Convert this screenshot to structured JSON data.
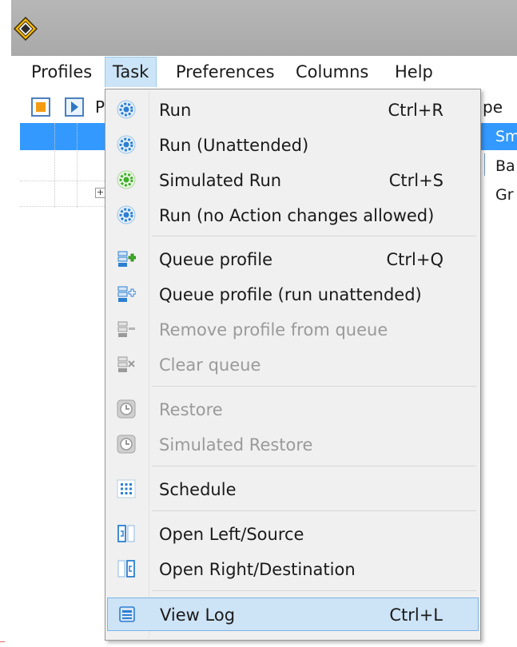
{
  "menubar": {
    "items": [
      {
        "label": "Profiles"
      },
      {
        "label": "Task"
      },
      {
        "label": "Preferences"
      },
      {
        "label": "Columns"
      },
      {
        "label": "Help"
      }
    ]
  },
  "grid": {
    "header_fragment_left": "P",
    "header_fragment_right": "pe",
    "rows": [
      {
        "text": "Sm"
      },
      {
        "text": "Ba"
      },
      {
        "text": "Gr"
      }
    ]
  },
  "task_menu": {
    "items": [
      {
        "label": "Run",
        "shortcut": "Ctrl+R",
        "icon": "gear-icon",
        "enabled": true
      },
      {
        "label": "Run (Unattended)",
        "shortcut": "",
        "icon": "gear-icon",
        "enabled": true
      },
      {
        "label": "Simulated Run",
        "shortcut": "Ctrl+S",
        "icon": "gear-green-icon",
        "enabled": true
      },
      {
        "label": "Run (no Action changes allowed)",
        "shortcut": "",
        "icon": "gear-icon",
        "enabled": true
      },
      {
        "label": "Queue profile",
        "shortcut": "Ctrl+Q",
        "icon": "queue-add-icon",
        "enabled": true
      },
      {
        "label": "Queue profile (run unattended)",
        "shortcut": "",
        "icon": "queue-add-outline-icon",
        "enabled": true
      },
      {
        "label": "Remove profile from queue",
        "shortcut": "",
        "icon": "queue-remove-icon",
        "enabled": false
      },
      {
        "label": "Clear queue",
        "shortcut": "",
        "icon": "queue-clear-icon",
        "enabled": false
      },
      {
        "label": "Restore",
        "shortcut": "",
        "icon": "clock-restore-icon",
        "enabled": false
      },
      {
        "label": "Simulated Restore",
        "shortcut": "",
        "icon": "clock-restore-icon",
        "enabled": false
      },
      {
        "label": "Schedule",
        "shortcut": "",
        "icon": "schedule-grid-icon",
        "enabled": true
      },
      {
        "label": "Open Left/Source",
        "shortcut": "",
        "icon": "open-left-icon",
        "enabled": true
      },
      {
        "label": "Open Right/Destination",
        "shortcut": "",
        "icon": "open-right-icon",
        "enabled": true
      },
      {
        "label": "View Log",
        "shortcut": "Ctrl+L",
        "icon": "view-log-icon",
        "enabled": true
      }
    ]
  },
  "colors": {
    "selection": "#3399ff",
    "menu_highlight": "#cde3f6",
    "active_menu": "#cce4f7",
    "icon_blue": "#2d7fd2",
    "icon_green": "#3fae2a"
  }
}
